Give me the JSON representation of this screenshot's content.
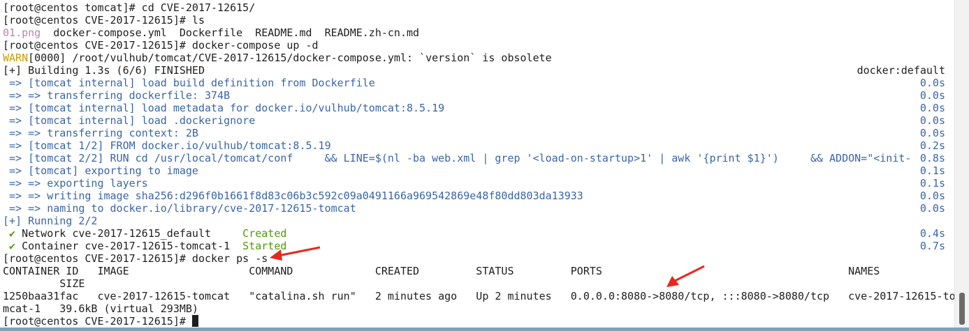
{
  "terminal": {
    "colors": {
      "prompt": "#1e1e1e",
      "build": "#3a65a8",
      "success": "#4e9a06",
      "warn": "#c4a000",
      "file_png": "#b585b0",
      "arrow": "#e8271c"
    },
    "lines": [
      {
        "segments": [
          {
            "text": "[root@centos tomcat]# cd CVE-2017-12615/",
            "color": "black"
          }
        ]
      },
      {
        "segments": [
          {
            "text": "[root@centos CVE-2017-12615]# ls",
            "color": "black"
          }
        ]
      },
      {
        "segments": [
          {
            "text": "01.png",
            "color": "purple"
          },
          {
            "text": "  docker-compose.yml  Dockerfile  README.md  README.zh-cn.md",
            "color": "black"
          }
        ]
      },
      {
        "segments": [
          {
            "text": "[root@centos CVE-2017-12615]# docker-compose up -d",
            "color": "black"
          }
        ]
      },
      {
        "segments": [
          {
            "text": "WARN",
            "color": "yellow"
          },
          {
            "text": "[0000] /root/vulhub/tomcat/CVE-2017-12615/docker-compose.yml: `version` is obsolete",
            "color": "black"
          }
        ]
      },
      {
        "segments": [
          {
            "text": "[+] Building 1.3s (6/6) FINISHED",
            "color": "black"
          }
        ],
        "right": {
          "text": "docker:default",
          "color": "black"
        }
      },
      {
        "segments": [
          {
            "text": " => [tomcat internal] load build definition from Dockerfile",
            "color": "blue"
          }
        ],
        "right": {
          "text": "0.0s",
          "color": "blue"
        }
      },
      {
        "segments": [
          {
            "text": " => => transferring dockerfile: 374B",
            "color": "blue"
          }
        ],
        "right": {
          "text": "0.0s",
          "color": "blue"
        }
      },
      {
        "segments": [
          {
            "text": " => [tomcat internal] load metadata for docker.io/vulhub/tomcat:8.5.19",
            "color": "blue"
          }
        ],
        "right": {
          "text": "0.0s",
          "color": "blue"
        }
      },
      {
        "segments": [
          {
            "text": " => [tomcat internal] load .dockerignore",
            "color": "blue"
          }
        ],
        "right": {
          "text": "0.0s",
          "color": "blue"
        }
      },
      {
        "segments": [
          {
            "text": " => => transferring context: 2B",
            "color": "blue"
          }
        ],
        "right": {
          "text": "0.0s",
          "color": "blue"
        }
      },
      {
        "segments": [
          {
            "text": " => [tomcat 1/2] FROM docker.io/vulhub/tomcat:8.5.19",
            "color": "blue"
          }
        ],
        "right": {
          "text": "0.2s",
          "color": "blue"
        }
      },
      {
        "segments": [
          {
            "text": " => [tomcat 2/2] RUN cd /usr/local/tomcat/conf     && LINE=$(nl -ba web.xml | grep '<load-on-startup>1' | awk '{print $1}')     && ADDON=\"<init-",
            "color": "blue"
          }
        ],
        "right": {
          "text": "0.8s",
          "color": "blue"
        }
      },
      {
        "segments": [
          {
            "text": " => [tomcat] exporting to image",
            "color": "blue"
          }
        ],
        "right": {
          "text": "0.1s",
          "color": "blue"
        }
      },
      {
        "segments": [
          {
            "text": " => => exporting layers",
            "color": "blue"
          }
        ],
        "right": {
          "text": "0.1s",
          "color": "blue"
        }
      },
      {
        "segments": [
          {
            "text": " => => writing image sha256:d296f0b1661f8d83c06b3c592c09a0491166a969542869e48f80dd803da13933",
            "color": "blue"
          }
        ],
        "right": {
          "text": "0.0s",
          "color": "blue"
        }
      },
      {
        "segments": [
          {
            "text": " => => naming to docker.io/library/cve-2017-12615-tomcat",
            "color": "blue"
          }
        ],
        "right": {
          "text": "0.0s",
          "color": "blue"
        }
      },
      {
        "segments": [
          {
            "text": "[+] Running 2/2",
            "color": "blue"
          }
        ]
      },
      {
        "segments": [
          {
            "text": " ✔",
            "color": "green"
          },
          {
            "text": " Network cve-2017-12615_default     ",
            "color": "black"
          },
          {
            "text": "Created",
            "color": "green"
          }
        ],
        "right": {
          "text": "0.4s",
          "color": "blue"
        }
      },
      {
        "segments": [
          {
            "text": " ✔",
            "color": "green"
          },
          {
            "text": " Container cve-2017-12615-tomcat-1  ",
            "color": "black"
          },
          {
            "text": "Started",
            "color": "green"
          }
        ],
        "right": {
          "text": "0.7s",
          "color": "blue"
        }
      },
      {
        "segments": [
          {
            "text": "[root@centos CVE-2017-12615]# docker ps -s",
            "color": "black"
          }
        ]
      },
      {
        "segments": [
          {
            "text": "CONTAINER ID   IMAGE                   COMMAND             CREATED         STATUS         PORTS                                       NAMES",
            "color": "black"
          }
        ]
      },
      {
        "segments": [
          {
            "text": "         SIZE",
            "color": "black"
          }
        ]
      },
      {
        "segments": [
          {
            "text": "1250baa31fac   cve-2017-12615-tomcat   \"catalina.sh run\"   2 minutes ago   Up 2 minutes   0.0.0.0:8080->8080/tcp, :::8080->8080/tcp   cve-2017-12615-to",
            "color": "black"
          }
        ]
      },
      {
        "segments": [
          {
            "text": "mcat-1   39.6kB (virtual 293MB)",
            "color": "black"
          }
        ]
      },
      {
        "segments": [
          {
            "text": "[root@centos CVE-2017-12615]# ",
            "color": "black"
          }
        ],
        "cursor": true
      }
    ]
  }
}
